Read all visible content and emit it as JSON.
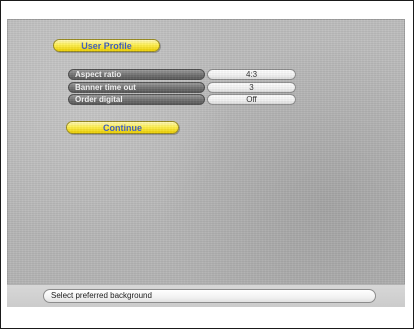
{
  "screen": {
    "title": "User Profile",
    "settings": [
      {
        "label": "Aspect ratio",
        "value": "4:3"
      },
      {
        "label": "Banner time out",
        "value": "3"
      },
      {
        "label": "Order digital",
        "value": "Off"
      }
    ],
    "continue_label": "Continue"
  },
  "status": {
    "hint": "Select preferred background"
  },
  "colors": {
    "background": "#b9b9b9",
    "accent_yellow": "#fff04f",
    "accent_blue_text": "#3e5dc0",
    "label_gray": "#707070",
    "value_white": "#f8f8f8"
  }
}
